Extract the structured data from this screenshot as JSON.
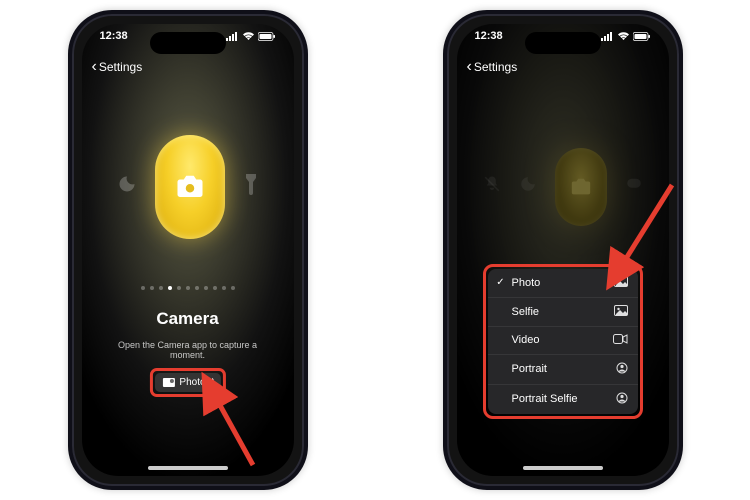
{
  "status": {
    "time": "12:38"
  },
  "nav": {
    "back": "Settings"
  },
  "left": {
    "title": "Camera",
    "subtitle": "Open the Camera app to capture a moment.",
    "mode_button": "Photo",
    "page_dots": 11,
    "active_dot": 3
  },
  "menu": {
    "items": [
      {
        "label": "Photo",
        "checked": true,
        "icon": "picture"
      },
      {
        "label": "Selfie",
        "checked": false,
        "icon": "picture"
      },
      {
        "label": "Video",
        "checked": false,
        "icon": "video"
      },
      {
        "label": "Portrait",
        "checked": false,
        "icon": "portrait"
      },
      {
        "label": "Portrait Selfie",
        "checked": false,
        "icon": "portrait"
      }
    ]
  },
  "colors": {
    "highlight": "#e53d2f",
    "accent": "#f6cf28"
  }
}
